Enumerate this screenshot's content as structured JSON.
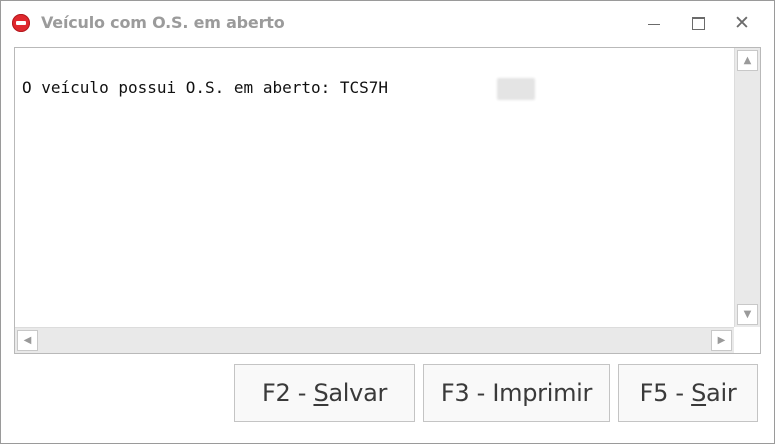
{
  "window": {
    "title": "Veículo com O.S. em aberto",
    "title_color": "#9b9b9b",
    "icon": "stop-error-icon",
    "icon_color": "#e0282e"
  },
  "controls": {
    "minimize_icon": "minimize-icon",
    "maximize_icon": "maximize-icon",
    "close_icon": "close-icon",
    "close_glyph": "✕"
  },
  "message": {
    "text": "O veículo possui O.S. em aberto: TCS7H"
  },
  "scrollbars": {
    "up_glyph": "▲",
    "down_glyph": "▼",
    "left_glyph": "◀",
    "right_glyph": "▶"
  },
  "buttons": {
    "salvar": {
      "prefix": "F2 - ",
      "accel": "S",
      "suffix": "alvar"
    },
    "imprimir": {
      "label": "F3 - Imprimir"
    },
    "sair": {
      "prefix": "F5 - ",
      "accel": "S",
      "suffix": "air"
    }
  }
}
